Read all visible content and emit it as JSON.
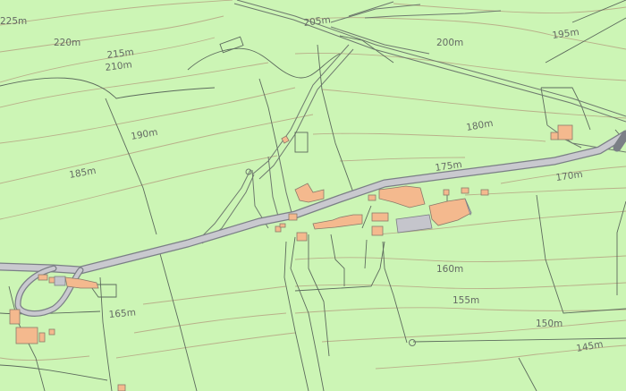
{
  "map": {
    "background_color": "#ccf5b5",
    "contour_color": "#b9b08a",
    "building_color": "#f4b98e",
    "road_color": "#c9c9cf"
  },
  "contour_labels": {
    "l225": "225m",
    "l220": "220m",
    "l215": "215m",
    "l210": "210m",
    "l205": "205m",
    "l200": "200m",
    "l195": "195m",
    "l190": "190m",
    "l185": "185m",
    "l180": "180m",
    "l175": "175m",
    "l170": "170m",
    "l165": "165m",
    "l160": "160m",
    "l155": "155m",
    "l150": "150m",
    "l145": "145m"
  }
}
